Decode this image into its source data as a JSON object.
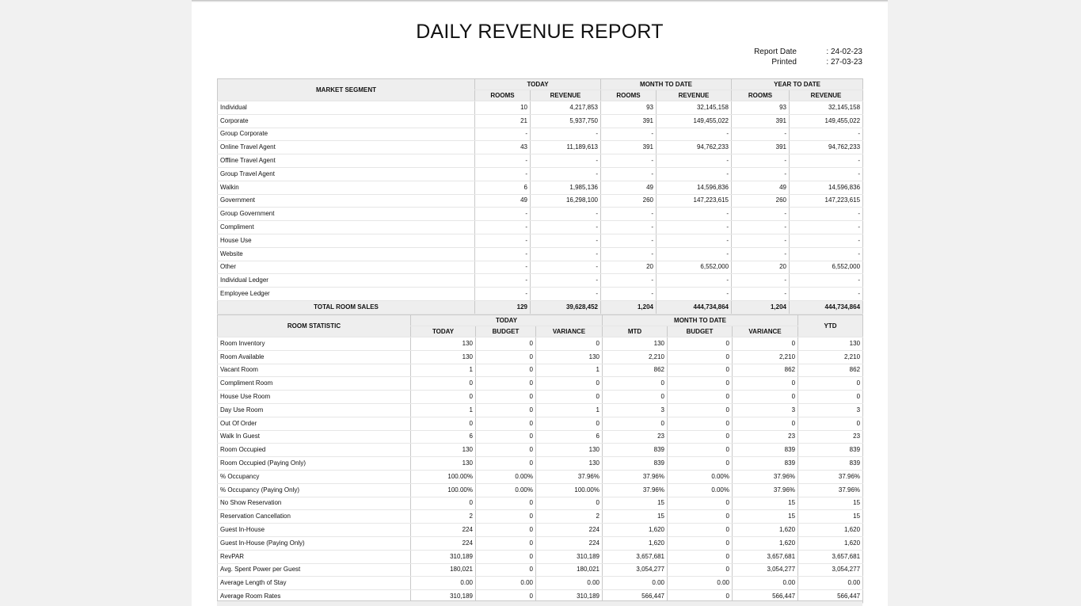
{
  "title": "DAILY REVENUE REPORT",
  "meta": {
    "report_date_label": "Report Date",
    "report_date_value": ": 24-02-23",
    "printed_label": "Printed",
    "printed_value": ": 27-03-23"
  },
  "segment": {
    "header": "MARKET SEGMENT",
    "groups": [
      "TODAY",
      "MONTH TO DATE",
      "YEAR TO DATE"
    ],
    "sub": [
      "ROOMS",
      "REVENUE",
      "ROOMS",
      "REVENUE",
      "ROOMS",
      "REVENUE"
    ],
    "rows": [
      [
        "Individual",
        "10",
        "4,217,853",
        "93",
        "32,145,158",
        "93",
        "32,145,158"
      ],
      [
        "Corporate",
        "21",
        "5,937,750",
        "391",
        "149,455,022",
        "391",
        "149,455,022"
      ],
      [
        "Group Corporate",
        "-",
        "-",
        "-",
        "-",
        "-",
        "-"
      ],
      [
        "Online Travel Agent",
        "43",
        "11,189,613",
        "391",
        "94,762,233",
        "391",
        "94,762,233"
      ],
      [
        "Offline Travel Agent",
        "-",
        "-",
        "-",
        "-",
        "-",
        "-"
      ],
      [
        "Group Travel Agent",
        "-",
        "-",
        "-",
        "-",
        "-",
        "-"
      ],
      [
        "Walkin",
        "6",
        "1,985,136",
        "49",
        "14,596,836",
        "49",
        "14,596,836"
      ],
      [
        "Government",
        "49",
        "16,298,100",
        "260",
        "147,223,615",
        "260",
        "147,223,615"
      ],
      [
        "Group Government",
        "-",
        "-",
        "-",
        "-",
        "-",
        "-"
      ],
      [
        "Compliment",
        "-",
        "-",
        "-",
        "-",
        "-",
        "-"
      ],
      [
        "House Use",
        "-",
        "-",
        "-",
        "-",
        "-",
        "-"
      ],
      [
        "Website",
        "-",
        "-",
        "-",
        "-",
        "-",
        "-"
      ],
      [
        "Other",
        "-",
        "-",
        "20",
        "6,552,000",
        "20",
        "6,552,000"
      ],
      [
        "Individual Ledger",
        "-",
        "-",
        "-",
        "-",
        "-",
        "-"
      ],
      [
        "Employee Ledger",
        "-",
        "-",
        "-",
        "-",
        "-",
        "-"
      ]
    ],
    "total": [
      "TOTAL ROOM SALES",
      "129",
      "39,628,452",
      "1,204",
      "444,734,864",
      "1,204",
      "444,734,864"
    ]
  },
  "statistic": {
    "header": "ROOM STATISTIC",
    "groups": [
      "TODAY",
      "MONTH TO DATE",
      "YTD"
    ],
    "sub": [
      "TODAY",
      "BUDGET",
      "VARIANCE",
      "MTD",
      "BUDGET",
      "VARIANCE"
    ],
    "rows": [
      [
        "Room Inventory",
        "130",
        "0",
        "0",
        "130",
        "0",
        "0",
        "130"
      ],
      [
        "Room Available",
        "130",
        "0",
        "130",
        "2,210",
        "0",
        "2,210",
        "2,210"
      ],
      [
        "Vacant Room",
        "1",
        "0",
        "1",
        "862",
        "0",
        "862",
        "862"
      ],
      [
        "Compliment Room",
        "0",
        "0",
        "0",
        "0",
        "0",
        "0",
        "0"
      ],
      [
        "House Use Room",
        "0",
        "0",
        "0",
        "0",
        "0",
        "0",
        "0"
      ],
      [
        "Day Use Room",
        "1",
        "0",
        "1",
        "3",
        "0",
        "3",
        "3"
      ],
      [
        "Out Of Order",
        "0",
        "0",
        "0",
        "0",
        "0",
        "0",
        "0"
      ],
      [
        "Walk In Guest",
        "6",
        "0",
        "6",
        "23",
        "0",
        "23",
        "23"
      ],
      [
        "Room Occupied",
        "130",
        "0",
        "130",
        "839",
        "0",
        "839",
        "839"
      ],
      [
        "Room Occupied (Paying Only)",
        "130",
        "0",
        "130",
        "839",
        "0",
        "839",
        "839"
      ],
      [
        "% Occupancy",
        "100.00%",
        "0.00%",
        "37.96%",
        "37.96%",
        "0.00%",
        "37.96%",
        "37.96%"
      ],
      [
        "% Occupancy (Paying Only)",
        "100.00%",
        "0.00%",
        "100.00%",
        "37.96%",
        "0.00%",
        "37.96%",
        "37.96%"
      ],
      [
        "No Show Reservation",
        "0",
        "0",
        "0",
        "15",
        "0",
        "15",
        "15"
      ],
      [
        "Reservation Cancellation",
        "2",
        "0",
        "2",
        "15",
        "0",
        "15",
        "15"
      ],
      [
        "Guest In-House",
        "224",
        "0",
        "224",
        "1,620",
        "0",
        "1,620",
        "1,620"
      ],
      [
        "Guest In-House (Paying Only)",
        "224",
        "0",
        "224",
        "1,620",
        "0",
        "1,620",
        "1,620"
      ],
      [
        "RevPAR",
        "310,189",
        "0",
        "310,189",
        "3,657,681",
        "0",
        "3,657,681",
        "3,657,681"
      ],
      [
        "Avg. Spent Power per Guest",
        "180,021",
        "0",
        "180,021",
        "3,054,277",
        "0",
        "3,054,277",
        "3,054,277"
      ],
      [
        "Average Length of Stay",
        "0.00",
        "0.00",
        "0.00",
        "0.00",
        "0.00",
        "0.00",
        "0.00"
      ],
      [
        "Average Room Rates",
        "310,189",
        "0",
        "310,189",
        "566,447",
        "0",
        "566,447",
        "566,447"
      ]
    ]
  }
}
